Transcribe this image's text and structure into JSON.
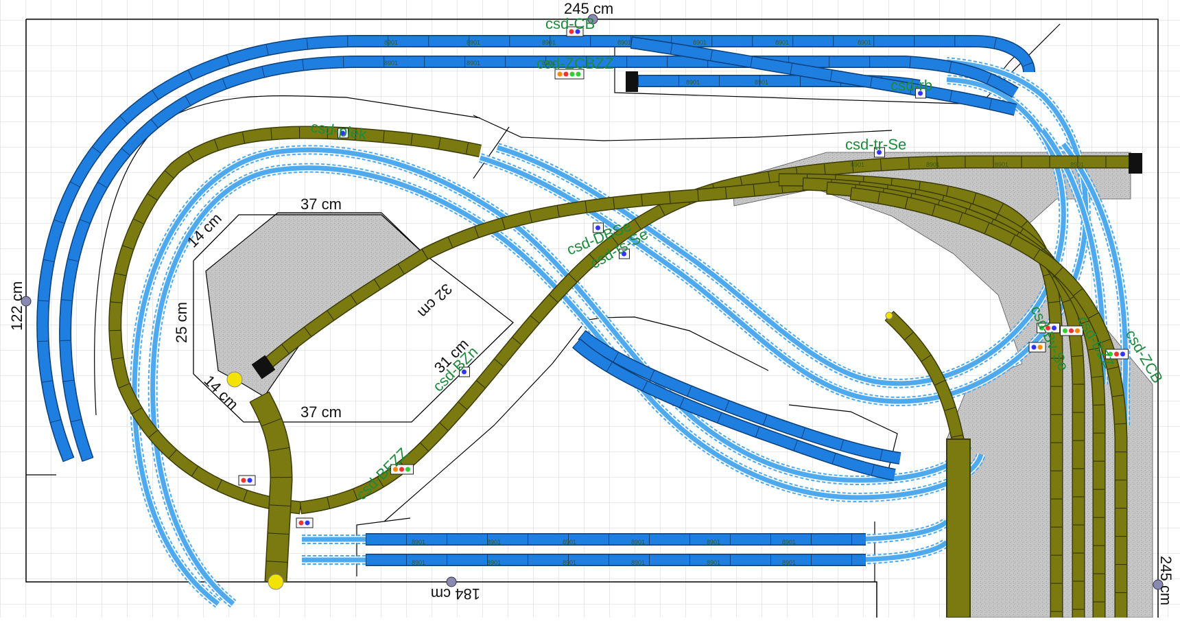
{
  "layout": {
    "dimensions": {
      "top_width": "245 cm",
      "left_height": "122 cm",
      "bottom_width": "184 cm",
      "right_height": "245 cm",
      "building_top": "37 cm",
      "building_bottom": "37 cm",
      "building_left": "25 cm",
      "building_nw": "14 cm",
      "building_sw": "14 cm",
      "building_ne": "32 cm",
      "building_se": "31 cm"
    },
    "signal_labels": {
      "top_outer": "csd-CB",
      "top_inner": "csd-ZCBZZ",
      "top_right": "csd-rb",
      "yard_entry": "csd-tr-Se",
      "upper_left": "csd-plek",
      "center_a": "csd-DBSe",
      "center_b": "csd-ts-Se",
      "lower_center": "csd-BZn",
      "lower_left": "csd-BFZZ",
      "right_a": "csd-ZCB",
      "right_b": "csd-BZZ",
      "right_c": "csd-Bv-Se"
    },
    "track_piece_label": "8901",
    "colors": {
      "grid": "#d6d6d6",
      "border": "#000000",
      "blue_track": "#1e7fe0",
      "blue_outline": "#0a3f7a",
      "olive_track": "#7a7a10",
      "olive_outline": "#3b3b05",
      "hidden_track": "#4ea9ee",
      "platform": "#c6c6c6",
      "label_green": "#1f8a3c",
      "marker_yellow": "#f2e400"
    }
  }
}
